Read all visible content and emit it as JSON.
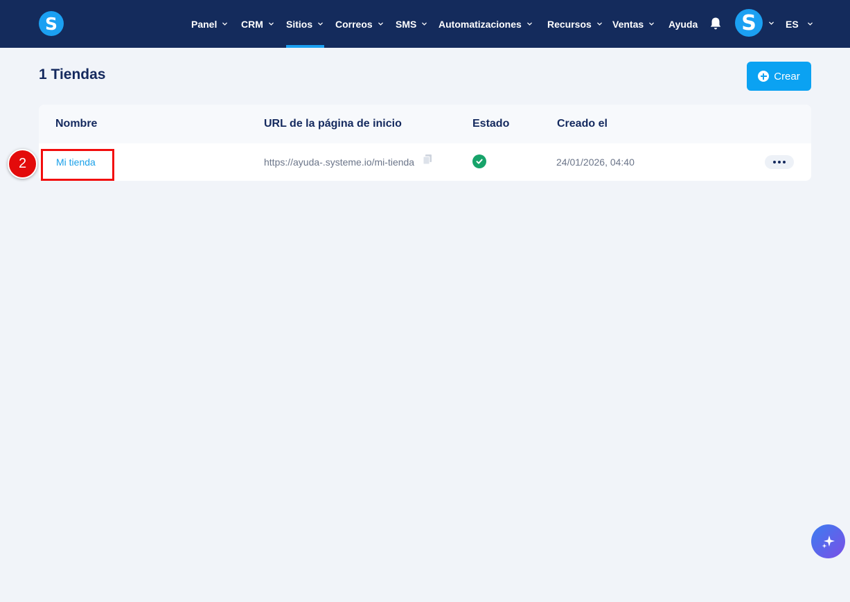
{
  "header": {
    "logo_letter": "S",
    "nav": [
      {
        "label": "Panel",
        "has_dropdown": true
      },
      {
        "label": "CRM",
        "has_dropdown": true
      },
      {
        "label": "Sitios",
        "has_dropdown": true,
        "active": true
      },
      {
        "label": "Correos",
        "has_dropdown": true
      },
      {
        "label": "SMS",
        "has_dropdown": true
      },
      {
        "label": "Automatizaciones",
        "has_dropdown": true
      },
      {
        "label": "Recursos",
        "has_dropdown": true
      },
      {
        "label": "Ventas",
        "has_dropdown": true
      },
      {
        "label": "Ayuda",
        "has_dropdown": false
      }
    ],
    "avatar_letter": "S",
    "language": "ES"
  },
  "page": {
    "title": "1 Tiendas",
    "create_label": "Crear"
  },
  "table": {
    "columns": [
      "Nombre",
      "URL de la página de inicio",
      "Estado",
      "Creado el"
    ],
    "rows": [
      {
        "name": "Mi tienda",
        "url": "https://ayuda-.systeme.io/mi-tienda",
        "status": "active",
        "created": "24/01/2026, 04:40"
      }
    ]
  },
  "annotation": {
    "step": "2"
  },
  "colors": {
    "header_bg": "#142b5c",
    "accent": "#1ba0f2",
    "status_ok": "#17a36a",
    "annotation_red": "#e30b0b"
  }
}
